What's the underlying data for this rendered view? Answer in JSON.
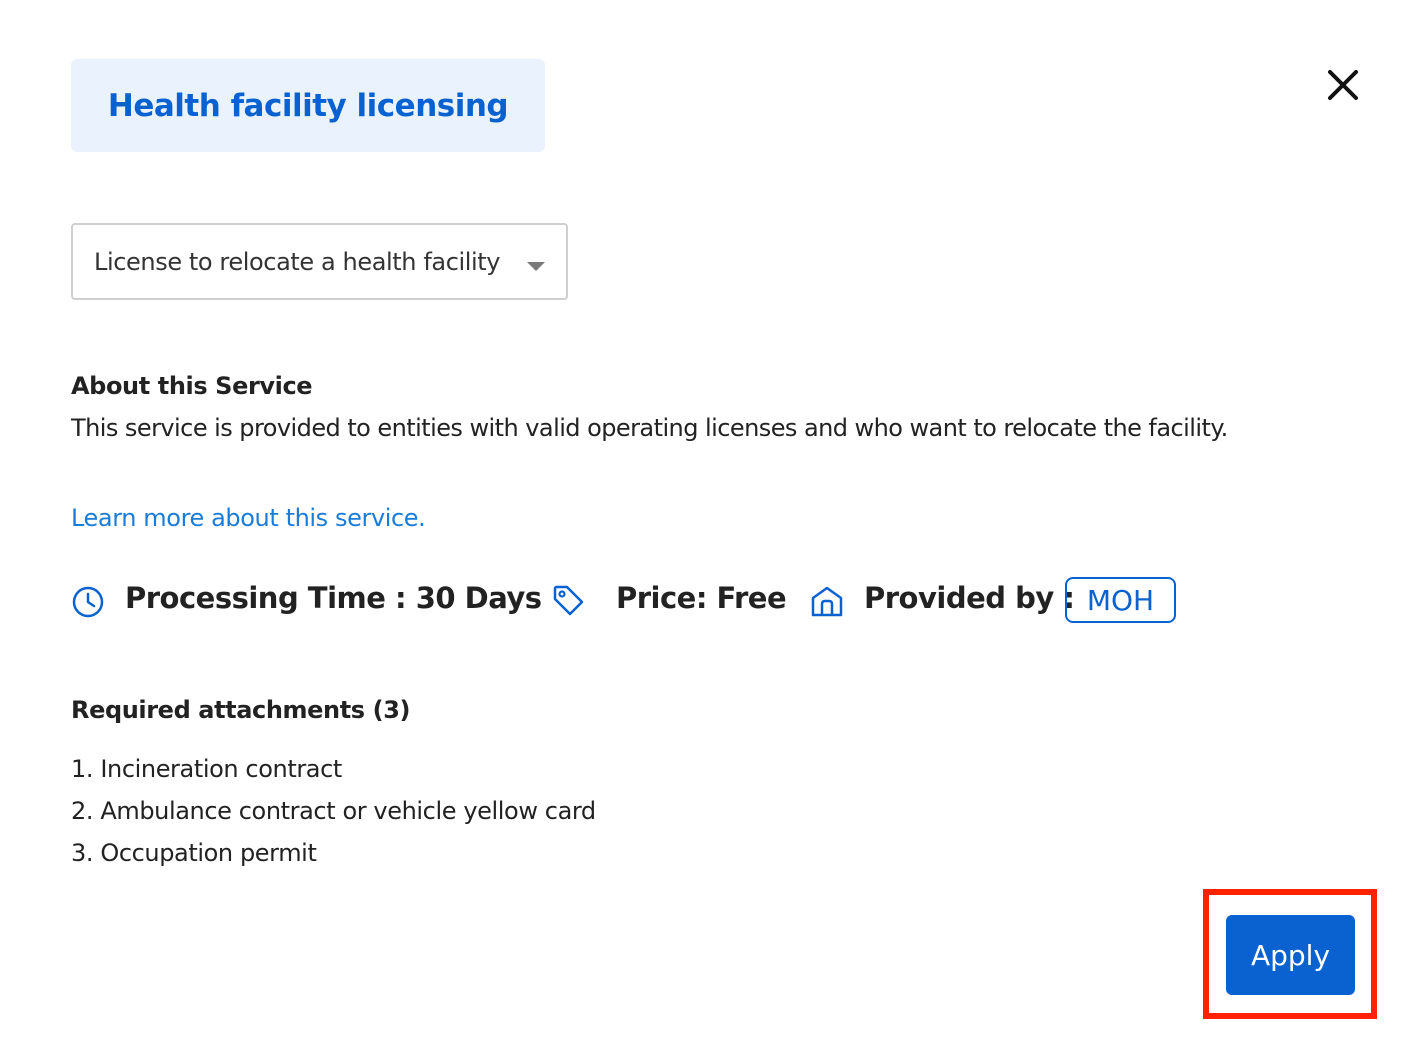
{
  "header": {
    "title": "Health facility licensing",
    "close_icon": "close-icon"
  },
  "service_select": {
    "selected_value": "License to relocate a health facility",
    "caret_icon": "chevron-down-icon"
  },
  "about": {
    "heading": "About this Service",
    "description": "This service is provided to entities with valid operating licenses and who want to relocate the facility.",
    "learn_more_link": "Learn more about this service."
  },
  "meta": {
    "processing_time": {
      "icon": "clock-icon",
      "label": "Processing Time : 30 Days"
    },
    "price": {
      "icon": "tag-icon",
      "label": "Price: Free"
    },
    "provider": {
      "icon": "building-icon",
      "label": "Provided by :",
      "badge": "MOH"
    }
  },
  "attachments": {
    "heading": "Required attachments (3)",
    "items": [
      "1. Incineration contract",
      "2. Ambulance contract or vehicle yellow card",
      "3. Occupation permit"
    ]
  },
  "actions": {
    "apply_label": "Apply"
  },
  "colors": {
    "accent": "#0a62d0",
    "link": "#1a7cd9",
    "title_chip_bg": "#eaf3fd",
    "highlight_border": "#ff2200"
  }
}
